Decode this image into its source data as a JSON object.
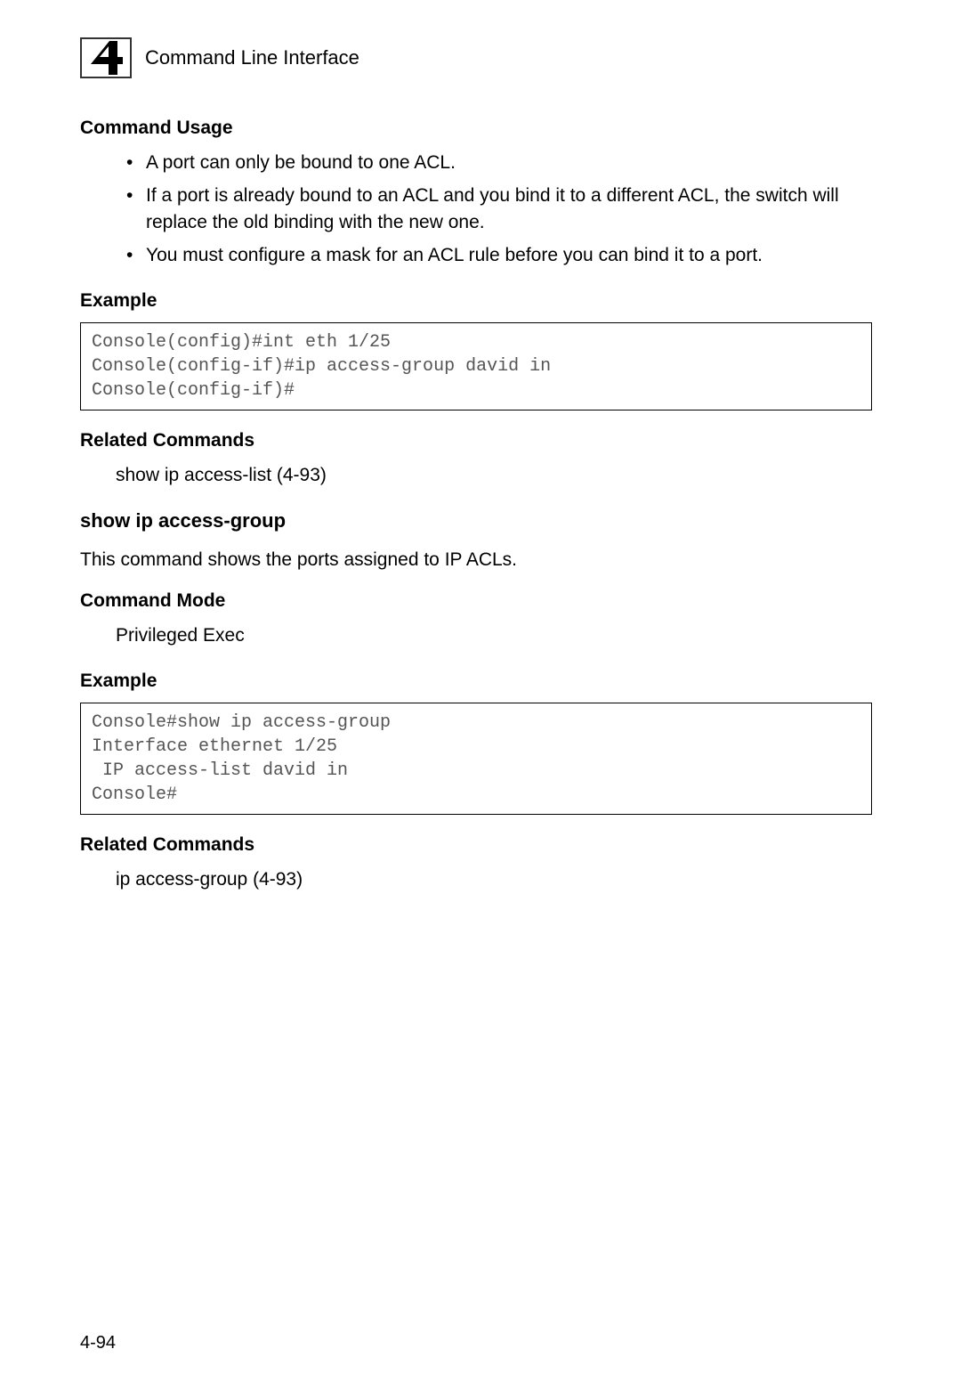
{
  "header": {
    "chapter_number": "4",
    "title": "Command Line Interface"
  },
  "section1": {
    "heading": "Command Usage",
    "bullets": [
      "A port can only be bound to one ACL.",
      "If a port is already bound to an ACL and you bind it to a different ACL, the switch will replace the old binding with the new one.",
      "You must configure a mask for an ACL rule before you can bind it to a port."
    ],
    "example_heading": "Example",
    "example_code": "Console(config)#int eth 1/25\nConsole(config-if)#ip access-group david in\nConsole(config-if)#",
    "related_heading": "Related Commands",
    "related_text": "show ip access-list (4-93)"
  },
  "section2": {
    "cmd_title": "show ip access-group",
    "cmd_desc": "This command shows the ports assigned to IP ACLs.",
    "mode_heading": "Command Mode",
    "mode_text": "Privileged Exec",
    "example_heading": "Example",
    "example_code": "Console#show ip access-group\nInterface ethernet 1/25\n IP access-list david in\nConsole#",
    "related_heading": "Related Commands",
    "related_text": "ip access-group (4-93)"
  },
  "footer": {
    "page_number": "4-94"
  }
}
